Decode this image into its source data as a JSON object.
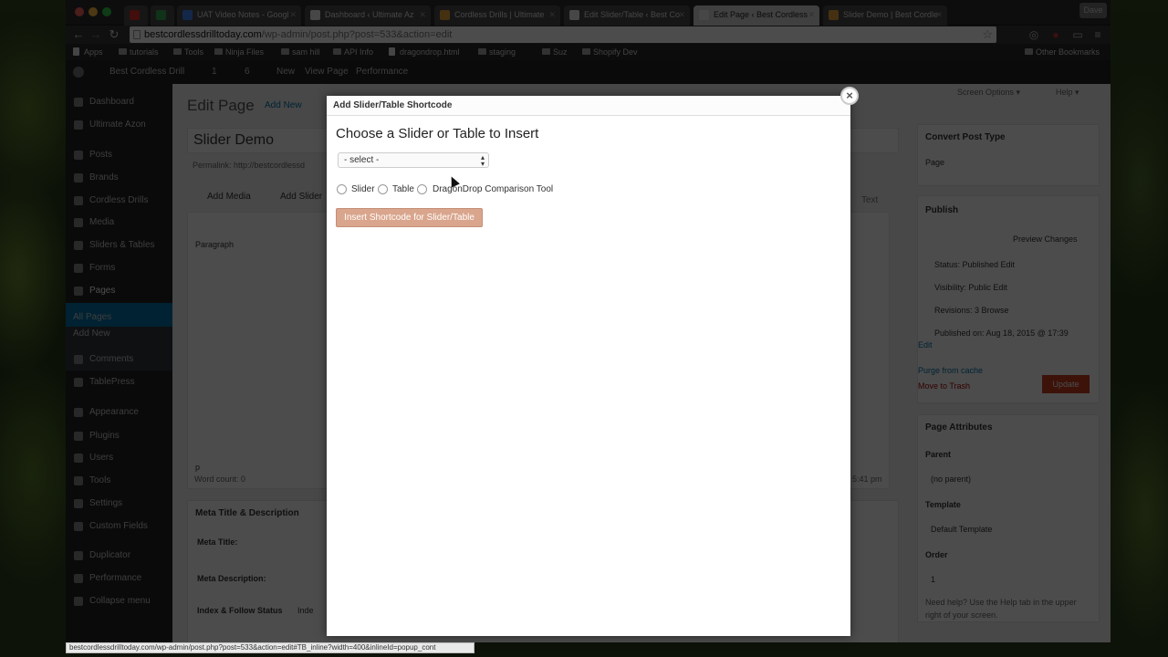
{
  "browser": {
    "tabs": [
      {
        "label": "",
        "favicon_color": "#d93025"
      },
      {
        "label": "",
        "favicon_color": "#34a853"
      },
      {
        "label": "UAT Video Notes - Googl",
        "favicon_color": "#4285f4"
      },
      {
        "label": "Dashboard ‹ Ultimate Az",
        "favicon_color": "#eeeeee"
      },
      {
        "label": "Cordless Drills | Ultimate",
        "favicon_color": "#e8a33d"
      },
      {
        "label": "Edit Slider/Table ‹ Best Co",
        "favicon_color": "#eeeeee"
      },
      {
        "label": "Edit Page ‹ Best Cordless",
        "favicon_color": "#eeeeee",
        "active": true
      },
      {
        "label": "Slider Demo | Best Cordle",
        "favicon_color": "#e8a33d"
      }
    ],
    "user_label": "Dave",
    "url_host": "bestcordlessdrilltoday.com",
    "url_path": "/wp-admin/post.php?post=533&action=edit",
    "bookmarks": [
      "Apps",
      "tutorials",
      "Tools",
      "Ninja Files",
      "sam hill",
      "API Info",
      "dragondrop.html",
      "staging",
      "Suz",
      "Shopify Dev",
      "Other Bookmarks"
    ],
    "status_url": "bestcordlessdrilltoday.com/wp-admin/post.php?post=533&action=edit#TB_inline?width=400&inlineId=popup_cont"
  },
  "wp": {
    "adminbar": {
      "site": "Best Cordless Drill",
      "updates": "1",
      "comments": "6",
      "new": "New",
      "view": "View Page",
      "performance": "Performance"
    },
    "menu": [
      "Dashboard",
      "Ultimate Azon",
      "Posts",
      "Brands",
      "Cordless Drills",
      "Media",
      "Sliders & Tables",
      "Forms",
      "Pages",
      "All Pages",
      "Add New",
      "Comments",
      "TablePress",
      "Appearance",
      "Plugins",
      "Users",
      "Tools",
      "Settings",
      "Custom Fields",
      "Duplicator",
      "Performance",
      "Collapse menu"
    ],
    "page_heading": "Edit Page",
    "add_new": "Add New",
    "post_title": "Slider Demo",
    "permalink": "Permalink: http://bestcordlessd",
    "add_media": "Add Media",
    "add_slider": "Add Slider",
    "paragraph": "Paragraph",
    "text_tab": "Text",
    "word_count": "Word count: 0",
    "p_tag": "p",
    "meta_title": "Meta Title & Description",
    "meta_title_label": "Meta Title:",
    "meta_desc_label": "Meta Description:",
    "index_follow": "Index & Follow Status",
    "index_val": "Inde",
    "screen_options": "Screen Options ▾",
    "help": "Help ▾",
    "convert_post_type": "Convert Post Type",
    "post_type_value": "Page",
    "publish": "Publish",
    "preview_changes": "Preview Changes",
    "status": "Status: Published Edit",
    "visibility": "Visibility: Public Edit",
    "revisions": "Revisions: 3 Browse",
    "published_on": "Published on: Aug 18, 2015 @ 17:39",
    "published_edit": "Edit",
    "purge_cache": "Purge from cache",
    "move_trash": "Move to Trash",
    "update": "Update",
    "page_attributes": "Page Attributes",
    "parent_label": "Parent",
    "parent_value": "(no parent)",
    "template_label": "Template",
    "template_value": "Default Template",
    "order_label": "Order",
    "order_value": "1",
    "help_text_1": "Need help? Use the Help tab in the upper",
    "help_text_2": "right of your screen.",
    "last_edited": "t 5:41 pm"
  },
  "modal": {
    "title": "Add Slider/Table Shortcode",
    "close": "×",
    "heading": "Choose a Slider or Table to Insert",
    "select_value": "- select -",
    "radios": [
      "Slider",
      "Table",
      "DragonDrop Comparison Tool"
    ],
    "insert_button": "Insert Shortcode for Slider/Table"
  }
}
